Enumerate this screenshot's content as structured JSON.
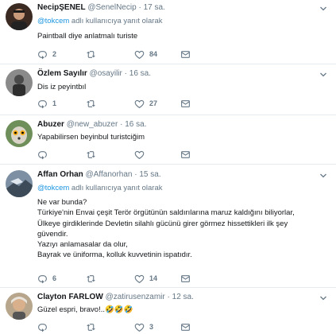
{
  "colors": {
    "accent": "#1b95e0",
    "muted": "#657786",
    "text": "#14171a",
    "divider": "#e6ecf0"
  },
  "icons": {
    "reply": "reply-icon",
    "retweet": "retweet-icon",
    "like": "heart-icon",
    "dm": "envelope-icon",
    "more": "chevron-down-icon"
  },
  "tweets": [
    {
      "name": "NecipŞENEL",
      "handle": "@SenelNecip",
      "dot": "·",
      "time": "17 sa.",
      "reply_mention": "@tokcem",
      "reply_suffix": " adlı kullanıcıya yanıt olarak",
      "text": "Paintball diye anlatmalı turiste",
      "reply_count": "2",
      "retweet_count": "",
      "like_count": "84"
    },
    {
      "name": "Özlem Sayılır",
      "handle": "@osayilir",
      "dot": "·",
      "time": "16 sa.",
      "text": "Dis iz peyintbıl",
      "reply_count": "1",
      "retweet_count": "",
      "like_count": "27"
    },
    {
      "name": "Abuzer",
      "handle": "@new_abuzer",
      "dot": "·",
      "time": "16 sa.",
      "text": "Yapabilirsen beyinbul turistciğim",
      "reply_count": "",
      "retweet_count": "",
      "like_count": ""
    },
    {
      "name": "Affan Orhan",
      "handle": "@Affanorhan",
      "dot": "·",
      "time": "15 sa.",
      "reply_mention": "@tokcem",
      "reply_suffix": " adlı kullanıcıya yanıt olarak",
      "lines": [
        "Ne var bunda?",
        "Türkiye'nin Envai çeşit Terör örgütünün saldırılarına maruz kaldığını biliyorlar,",
        "Ülkeye girdiklerinde Devletin silahlı gücünü girer görmez hissettikleri ilk şey",
        "güvendir.",
        "Yazıyı anlamasalar da olur,",
        "Bayrak ve üniforma, kolluk kuvvetinin ispatıdır."
      ],
      "reply_count": "6",
      "retweet_count": "",
      "like_count": "14"
    },
    {
      "name": "Clayton FARLOW",
      "handle": "@zatirusenzamir",
      "dot": "·",
      "time": "12 sa.",
      "text": "Güzel espri, bravo!..🤣🤣🤣",
      "reply_count": "",
      "retweet_count": "",
      "like_count": "3"
    }
  ]
}
